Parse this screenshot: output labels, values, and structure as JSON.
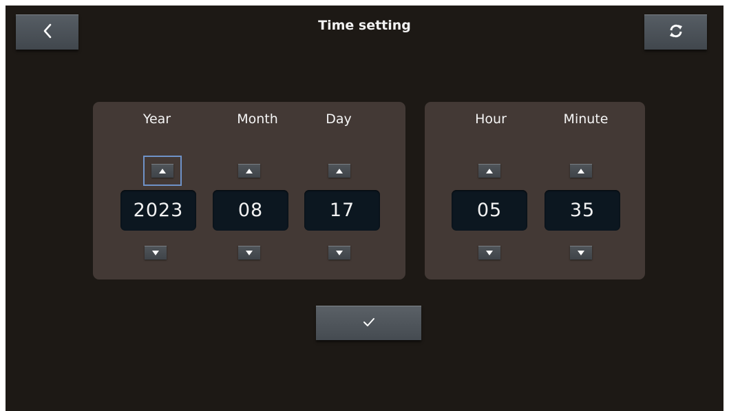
{
  "header": {
    "title": "Time setting",
    "back_icon": "chevron-left-icon",
    "refresh_icon": "refresh-icon"
  },
  "date_panel": {
    "columns": [
      {
        "label": "Year",
        "value": "2023"
      },
      {
        "label": "Month",
        "value": "08"
      },
      {
        "label": "Day",
        "value": "17"
      }
    ]
  },
  "time_panel": {
    "columns": [
      {
        "label": "Hour",
        "value": "05"
      },
      {
        "label": "Minute",
        "value": "35"
      }
    ]
  },
  "footer": {
    "confirm_icon": "checkmark-icon"
  },
  "colors": {
    "background": "#1d1915",
    "panel": "#433935",
    "value_box": "#0c1720",
    "focus": "#6f93c9"
  }
}
